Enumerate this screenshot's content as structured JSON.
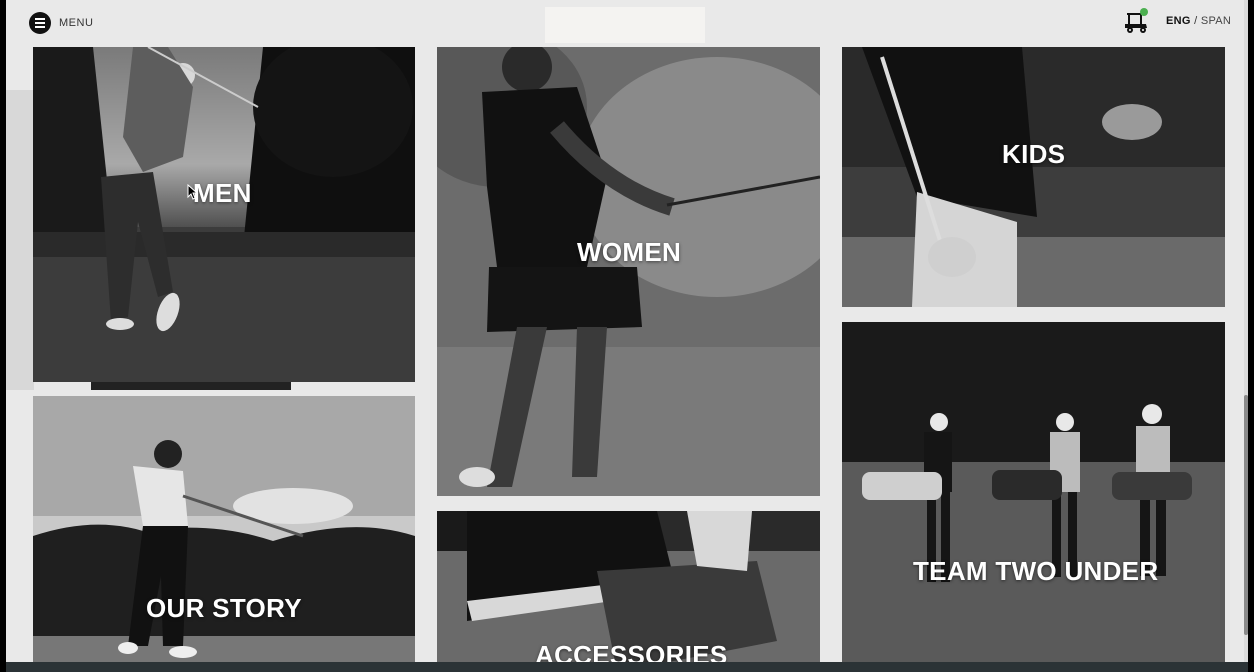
{
  "header": {
    "menu_label": "MENU",
    "lang_active": "ENG",
    "lang_separator": " / ",
    "lang_other": "SPAN",
    "cart_icon": "golf-cart-icon"
  },
  "tiles": {
    "men": "MEN",
    "women": "WOMEN",
    "kids": "KIDS",
    "our_story": "OUR STORY",
    "accessories": "ACCESSORIES",
    "team": "TEAM TWO UNDER"
  }
}
